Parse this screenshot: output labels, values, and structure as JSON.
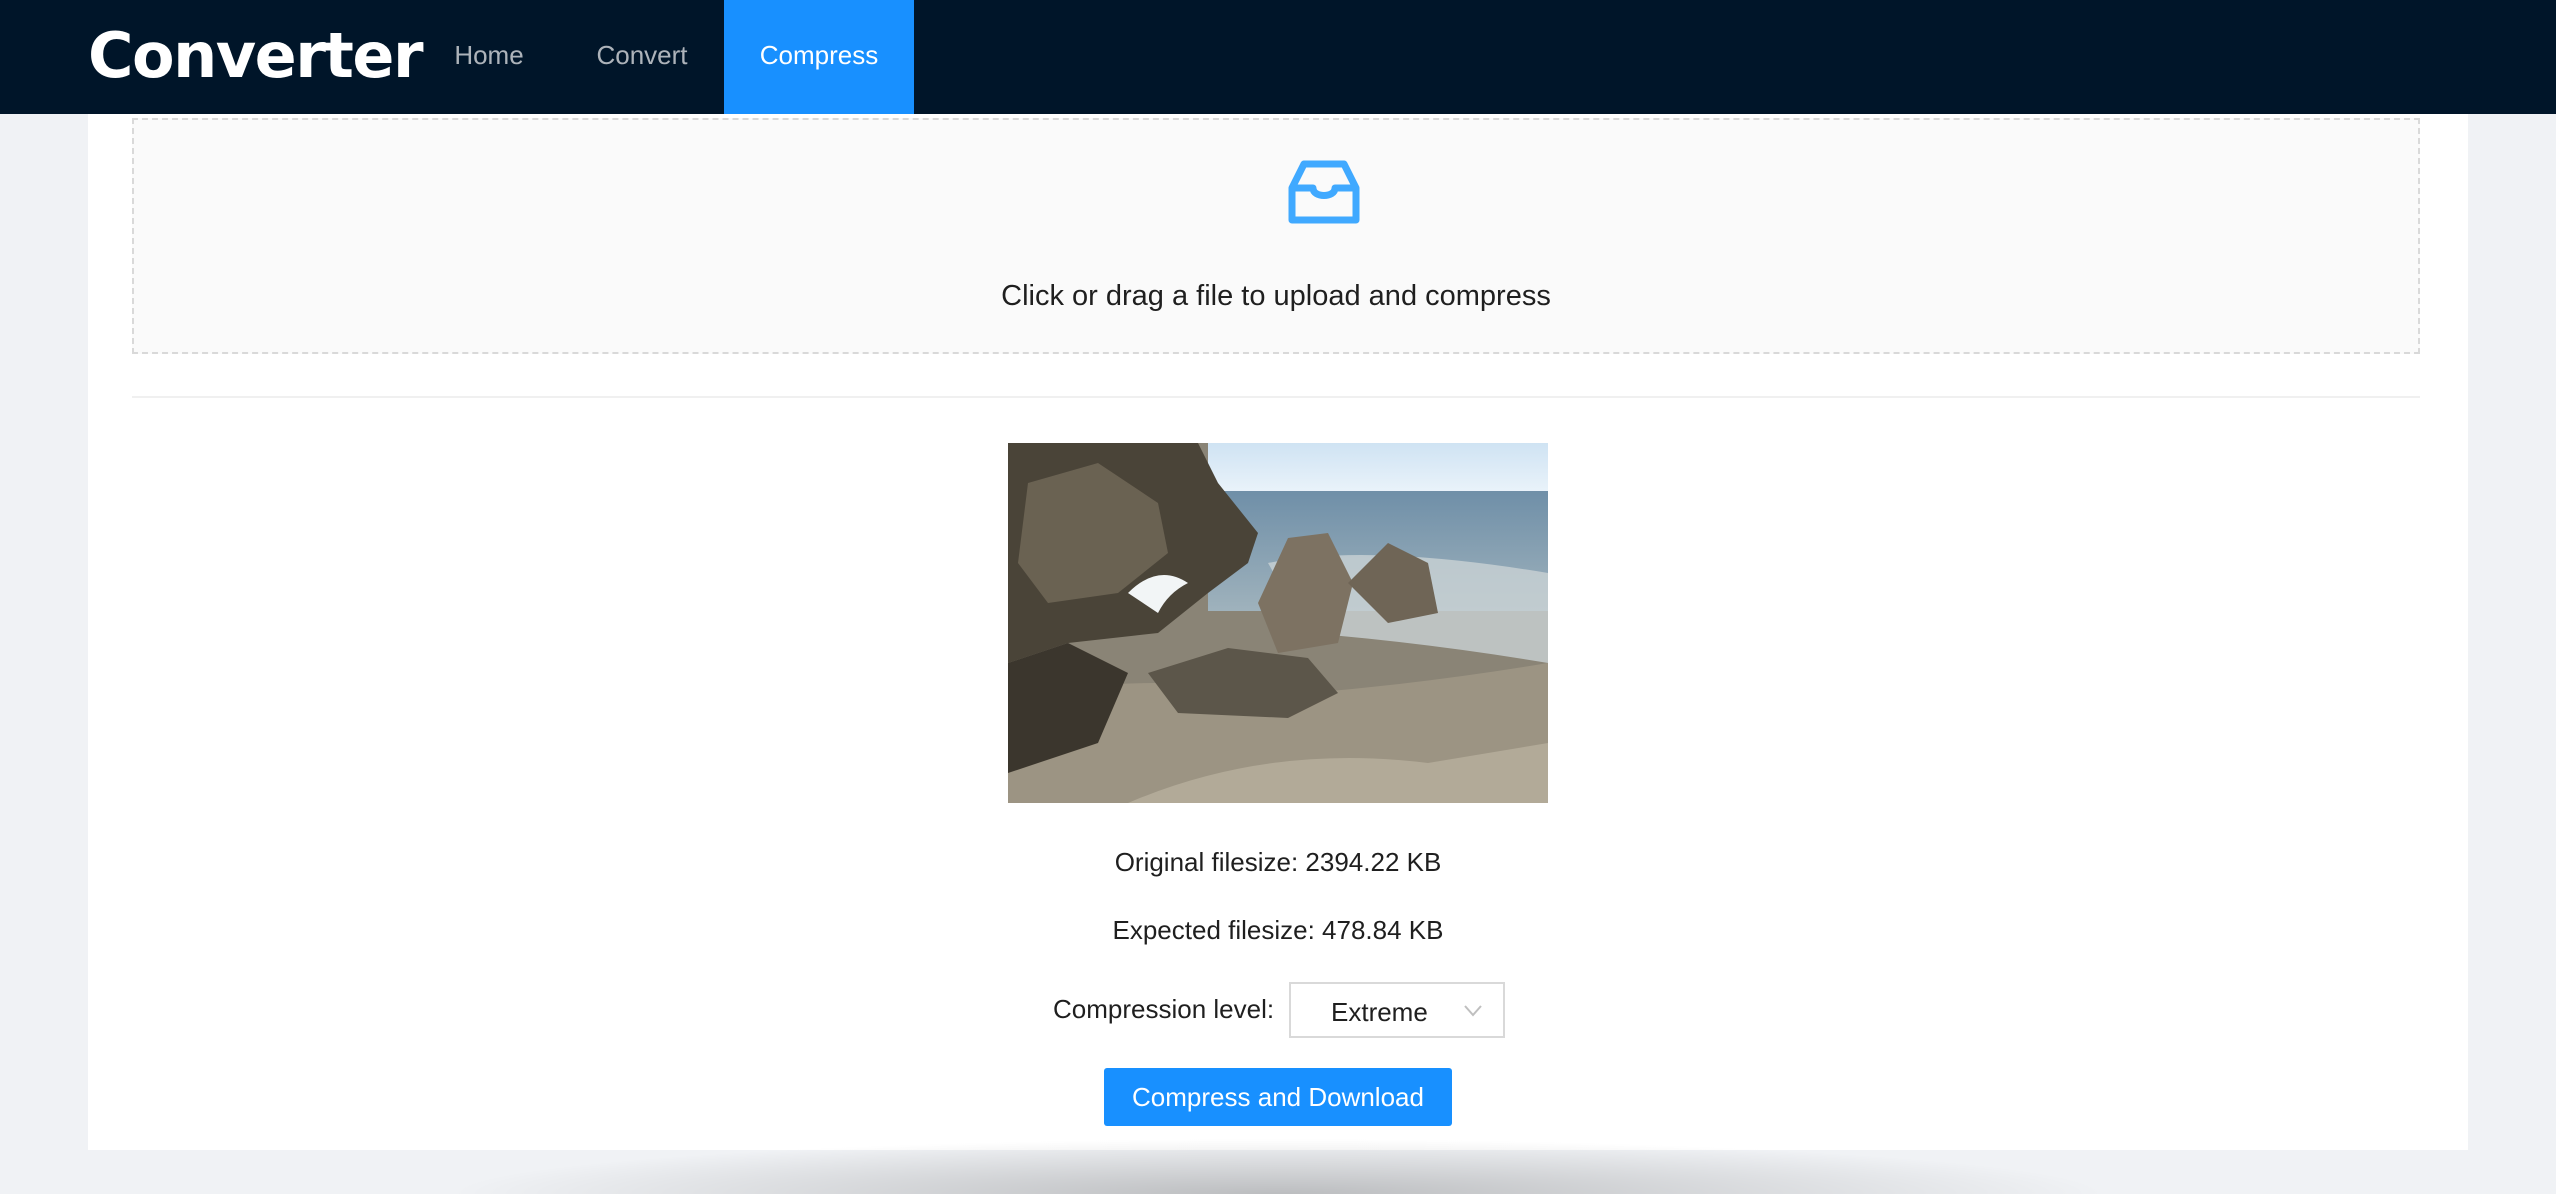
{
  "header": {
    "logo": "Converter",
    "nav": [
      {
        "label": "Home",
        "active": false
      },
      {
        "label": "Convert",
        "active": false
      },
      {
        "label": "Compress",
        "active": true
      }
    ]
  },
  "upload": {
    "icon": "inbox-icon",
    "text": "Click or drag a file to upload and compress"
  },
  "result": {
    "original_filesize": "Original filesize: 2394.22 KB",
    "expected_filesize": "Expected filesize: 478.84 KB",
    "compression_level_label": "Compression level:",
    "compression_level_value": "Extreme",
    "button_label": "Compress and Download"
  },
  "colors": {
    "header_bg": "#001529",
    "accent": "#1890ff",
    "page_bg": "#f0f2f5"
  }
}
